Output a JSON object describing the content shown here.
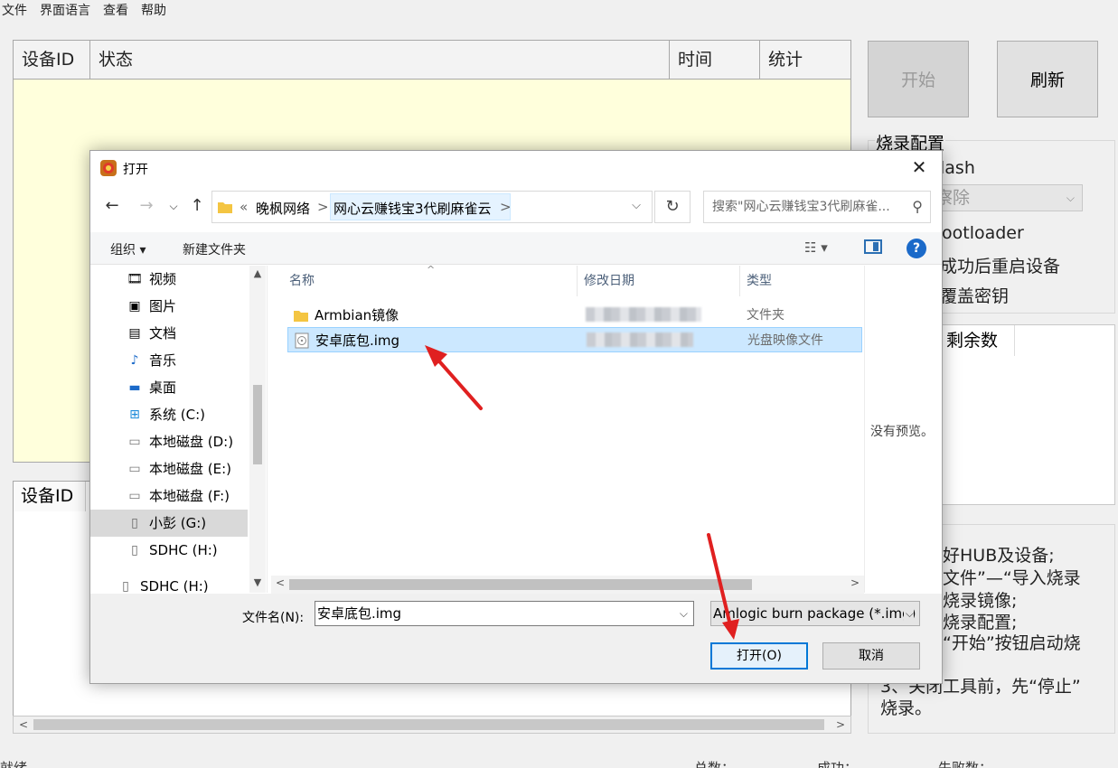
{
  "menu": [
    "文件",
    "界面语言",
    "查看",
    "帮助"
  ],
  "device_grid": {
    "headers": [
      "设备ID",
      "状态",
      "时间",
      "统计"
    ]
  },
  "log_grid": {
    "header": "设备ID"
  },
  "buttons": {
    "start": "开始",
    "refresh": "刷新"
  },
  "burn_config": {
    "title": "烧录配置",
    "flash_partial": "lash",
    "erase_partial": "察除",
    "bootloader_partial": "ootloader",
    "reboot_partial": "成功后重启设备",
    "overwrite_key_partial": "覆盖密钥"
  },
  "remain_panel": {
    "header": "剩余数"
  },
  "help_panel": {
    "lines": [
      "好HUB及设备;",
      "文件”—“导入烧录",
      "烧录镜像;",
      "烧录配置;",
      "“开始”按钮启动烧",
      "3、关闭工具前，先“停止”",
      "烧录。"
    ]
  },
  "statusbar": [
    "就绪",
    "总数：",
    "成功：",
    "失败数："
  ],
  "dialog": {
    "title": "打开",
    "breadcrumb": [
      "«",
      "晚枫网络",
      ">",
      "网心云赚钱宝3代刷麻雀云",
      ">"
    ],
    "search_placeholder": "搜索\"网心云赚钱宝3代刷麻雀...",
    "organize": "组织 ▾",
    "new_folder": "新建文件夹",
    "nav_items": [
      {
        "label": "视频",
        "icon": "video-icon"
      },
      {
        "label": "图片",
        "icon": "pictures-icon"
      },
      {
        "label": "文档",
        "icon": "documents-icon"
      },
      {
        "label": "音乐",
        "icon": "music-icon"
      },
      {
        "label": "桌面",
        "icon": "desktop-icon"
      },
      {
        "label": "系统 (C:)",
        "icon": "windows-drive-icon"
      },
      {
        "label": "本地磁盘 (D:)",
        "icon": "drive-icon"
      },
      {
        "label": "本地磁盘 (E:)",
        "icon": "drive-icon"
      },
      {
        "label": "本地磁盘 (F:)",
        "icon": "drive-icon"
      },
      {
        "label": "小彭 (G:)",
        "icon": "removable-drive-icon"
      },
      {
        "label": "SDHC (H:)",
        "icon": "removable-drive-icon"
      },
      {
        "label": "SDHC (H:)",
        "icon": "removable-drive-icon"
      }
    ],
    "columns": [
      "名称",
      "修改日期",
      "类型"
    ],
    "files": [
      {
        "name": "Armbian镜像",
        "type": "文件夹",
        "icon": "folder-icon",
        "selected": false
      },
      {
        "name": "安卓底包.img",
        "type": "光盘映像文件",
        "icon": "disc-image-icon",
        "selected": true
      }
    ],
    "preview_text": "没有预览。",
    "filename_label": "文件名(N):",
    "filename_value": "安卓底包.img",
    "filetype_value": "Amlogic burn package (*.img)",
    "open_button": "打开(O)",
    "cancel_button": "取消"
  },
  "colors": {
    "arrow": "#e02020",
    "selection": "#cce8ff",
    "grid_bg": "#ffffdc",
    "accent": "#0078d7"
  }
}
